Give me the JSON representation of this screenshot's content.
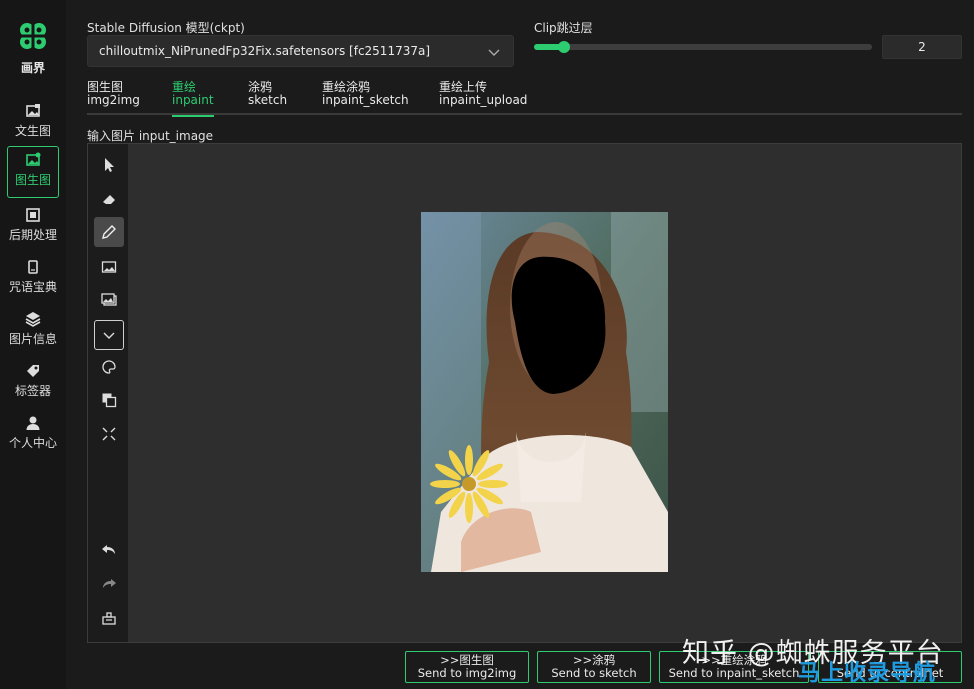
{
  "sidebar": {
    "logo_text": "画界",
    "items": [
      {
        "label": "文生图",
        "icon": "image-text-icon"
      },
      {
        "label": "图生图",
        "icon": "image-gen-icon"
      },
      {
        "label": "后期处理",
        "icon": "post-process-icon"
      },
      {
        "label": "咒语宝典",
        "icon": "book-icon"
      },
      {
        "label": "图片信息",
        "icon": "layers-icon"
      },
      {
        "label": "标签器",
        "icon": "tag-icon"
      },
      {
        "label": "个人中心",
        "icon": "user-icon"
      }
    ],
    "active_index": 1
  },
  "model": {
    "label": "Stable Diffusion 模型(ckpt)",
    "value": "chilloutmix_NiPrunedFp32Fix.safetensors [fc2511737a]"
  },
  "clip": {
    "label": "Clip跳过层",
    "value": "2",
    "slider_fraction": 0.09
  },
  "tabs": [
    {
      "label_cn": "图生图",
      "label_en": "img2img"
    },
    {
      "label_cn": "重绘",
      "label_en": "inpaint"
    },
    {
      "label_cn": "涂鸦",
      "label_en": "sketch"
    },
    {
      "label_cn": "重绘涂鸦",
      "label_en": "inpaint_sketch"
    },
    {
      "label_cn": "重绘上传",
      "label_en": "inpaint_upload"
    }
  ],
  "active_tab": 1,
  "input_label": "输入图片 input_image",
  "tools": [
    "pointer-icon",
    "eraser-icon",
    "pencil-icon",
    "image-icon",
    "image-stack-icon",
    "dropdown-icon",
    "palette-icon",
    "layers-copy-icon",
    "fit-screen-icon",
    "undo-icon",
    "redo-icon",
    "clear-icon"
  ],
  "send_buttons": [
    {
      "line1": ">>图生图",
      "line2": "Send to img2img"
    },
    {
      "line1": ">>涂鸦",
      "line2": "Send to sketch"
    },
    {
      "line1": ">>重绘涂鸦",
      "line2": "Send to inpaint_sketch"
    },
    {
      "line1": "",
      "line2": "Send to controlnet"
    }
  ],
  "watermark": {
    "line1": "知乎 @蜘蛛服务平台",
    "line2": "马上收录导航"
  },
  "colors": {
    "accent": "#2ecc71",
    "background": "#1b1b1b",
    "panel": "#2e2e2e"
  }
}
